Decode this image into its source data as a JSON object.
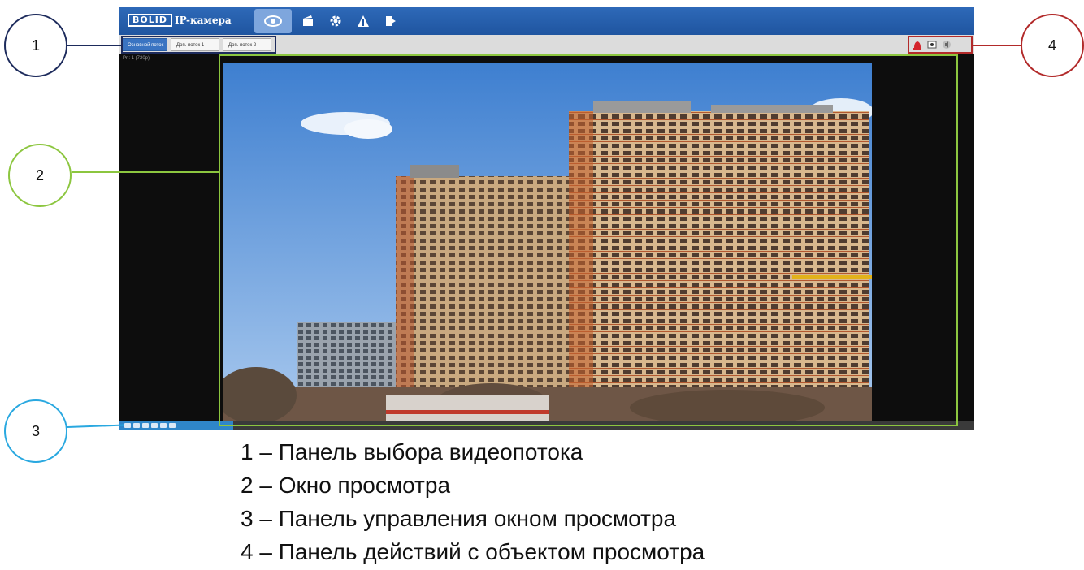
{
  "app": {
    "brand_logo": "BOLID",
    "title": "IP-камера",
    "nav": [
      {
        "icon": "eye-icon",
        "active": true
      },
      {
        "icon": "playback-icon",
        "active": false
      },
      {
        "icon": "gear-icon",
        "active": false
      },
      {
        "icon": "alarm-icon",
        "active": false
      },
      {
        "icon": "logout-icon",
        "active": false
      }
    ],
    "stream_tabs": [
      {
        "label": "Основной поток",
        "active": true
      },
      {
        "label": "Доп. поток 1",
        "active": false
      },
      {
        "label": "Доп. поток 2",
        "active": false
      }
    ],
    "osd_text": "Pn: 1 (720p)",
    "actions": [
      "record-icon",
      "snapshot-icon",
      "sound-icon"
    ],
    "colors": {
      "accent": "#2a62b0",
      "frame_1": "#1d2b5c",
      "frame_2": "#8cc63f",
      "frame_3": "#29a8e0",
      "frame_4": "#b22a2a"
    }
  },
  "callouts": [
    {
      "number": "1"
    },
    {
      "number": "2"
    },
    {
      "number": "3"
    },
    {
      "number": "4"
    }
  ],
  "legend": [
    "1 – Панель выбора видеопотока",
    "2 – Окно просмотра",
    "3 – Панель управления окном просмотра",
    "4 – Панель действий с объектом просмотра"
  ]
}
